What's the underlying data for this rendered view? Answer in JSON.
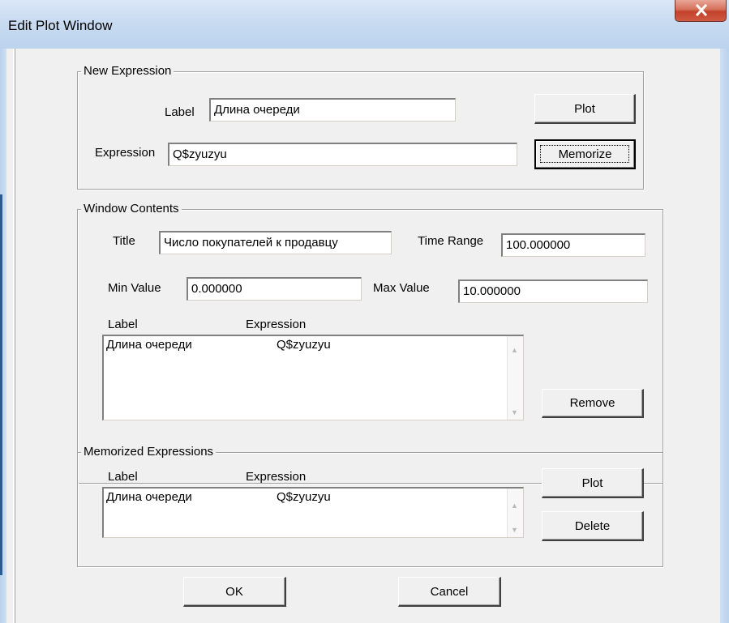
{
  "window": {
    "title": "Edit Plot Window"
  },
  "new_expression": {
    "legend": "New Expression",
    "label_caption": "Label",
    "label_value": "Длина очереди",
    "expression_caption": "Expression",
    "expression_value": "Q$zyuzyu",
    "plot_button": "Plot",
    "memorize_button": "Memorize"
  },
  "window_contents": {
    "legend": "Window Contents",
    "title_caption": "Title",
    "title_value": "Число покупателей к продавцу",
    "time_range_caption": "Time Range",
    "time_range_value": "100.000000",
    "min_value_caption": "Min Value",
    "min_value_value": "0.000000",
    "max_value_caption": "Max Value",
    "max_value_value": "10.000000",
    "col_label": "Label",
    "col_expression": "Expression",
    "rows": [
      {
        "label": "Длина очереди",
        "expression": "Q$zyuzyu"
      }
    ],
    "remove_button": "Remove"
  },
  "memorized": {
    "legend": "Memorized Expressions",
    "col_label": "Label",
    "col_expression": "Expression",
    "rows": [
      {
        "label": "Длина очереди",
        "expression": "Q$zyuzyu"
      }
    ],
    "plot_button": "Plot",
    "delete_button": "Delete"
  },
  "footer": {
    "ok_button": "OK",
    "cancel_button": "Cancel"
  },
  "icons": {
    "close": "close-icon",
    "scroll_up": "scroll-up-arrow-icon",
    "scroll_down": "scroll-down-arrow-icon"
  }
}
